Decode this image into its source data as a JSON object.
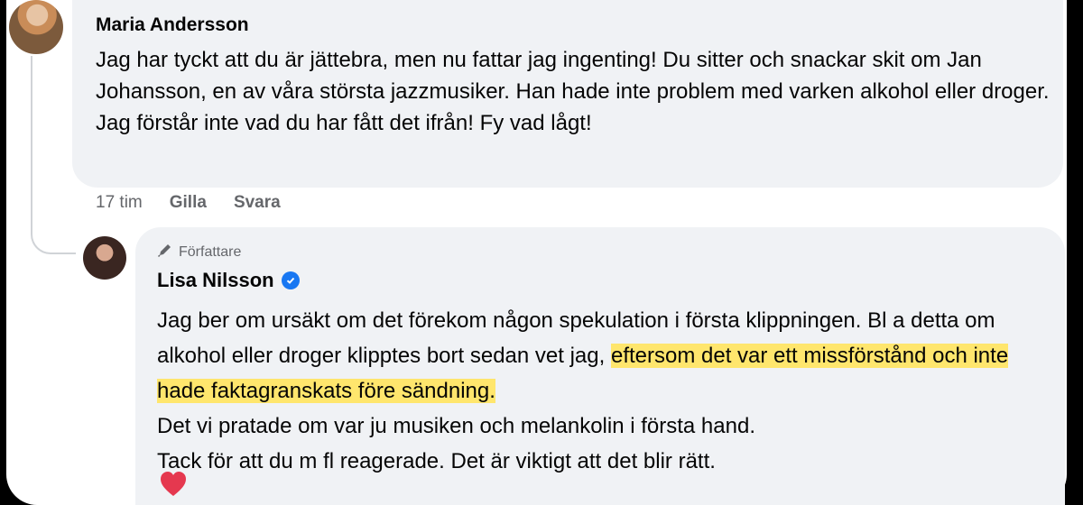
{
  "comment": {
    "author": "Maria Andersson",
    "text": "Jag har tyckt att du är jättebra, men nu fattar jag ingenting! Du sitter och snackar skit om Jan Johansson, en av våra största jazzmusiker. Han hade inte problem med varken alkohol eller droger. Jag förstår inte vad du har fått det ifrån! Fy vad lågt!",
    "time": "17 tim",
    "like_label": "Gilla",
    "reply_label": "Svara"
  },
  "reply": {
    "role_badge": "Författare",
    "author": "Lisa Nilsson",
    "text_part1": "Jag ber om ursäkt om det förekom någon spekulation i första klippningen. Bl a detta om alkohol eller droger klipptes bort sedan vet jag, ",
    "text_highlight": "eftersom det var ett missförstånd och inte hade faktagranskats före sändning.",
    "text_line2": "Det vi pratade om var ju musiken och melankolin i första hand.",
    "text_line3": "Tack för att du m fl reagerade. Det är viktigt att det blir rätt.",
    "reaction_icon": "heart-icon",
    "highlight_color": "#ffe66d",
    "verified_color": "#1877f2"
  }
}
